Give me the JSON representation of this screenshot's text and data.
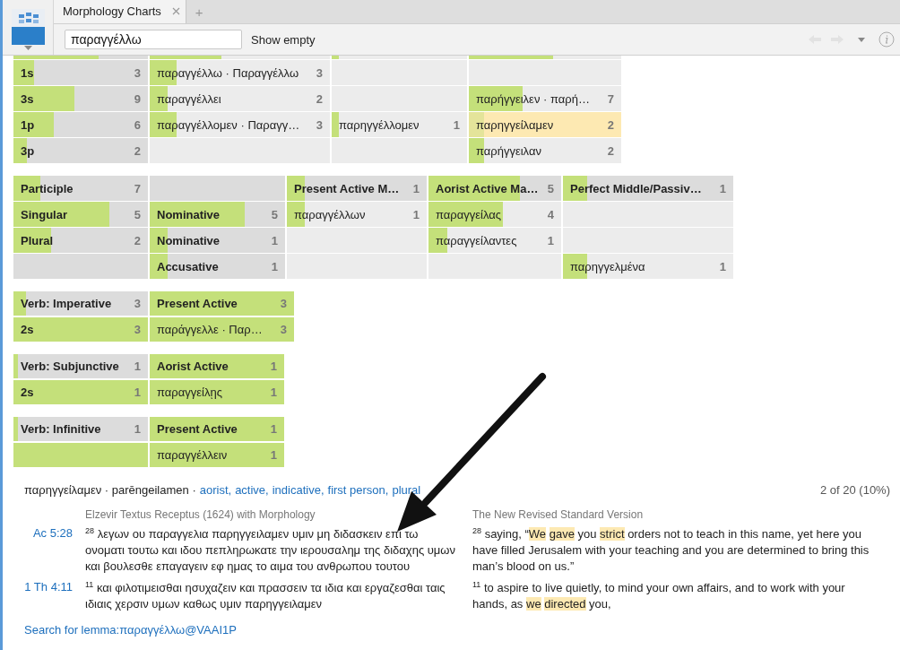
{
  "tabs": [
    {
      "label": "Morphology Charts",
      "selected": true
    }
  ],
  "new_tab": "+",
  "toolbar": {
    "search": {
      "value": "παραγγέλλω"
    },
    "show_empty": "Show empty",
    "back": {
      "disabled": true
    },
    "forward": {
      "disabled": true
    }
  },
  "charts": [
    {
      "rows": [
        [
          {
            "kind": "category",
            "level": 0.63
          },
          {
            "kind": "form",
            "level": 0.4
          },
          {
            "kind": "form",
            "level": 0.05
          },
          {
            "kind": "form",
            "level": 0.55
          }
        ],
        [
          {
            "kind": "category",
            "label": "1s",
            "count": "3",
            "level": 0.15
          },
          {
            "kind": "form",
            "label": "παραγγέλλω · Παραγγέλλω",
            "count": "3",
            "level": 0.15,
            "selected": false
          },
          {
            "kind": "empty"
          },
          {
            "kind": "empty"
          }
        ],
        [
          {
            "kind": "category",
            "label": "3s",
            "count": "9",
            "level": 0.45
          },
          {
            "kind": "form",
            "label": "παραγγέλλει",
            "count": "2",
            "level": 0.1,
            "selected": false
          },
          {
            "kind": "empty"
          },
          {
            "kind": "form",
            "label": "παρήγγειλεν · παρή…",
            "count": "7",
            "level": 0.35,
            "selected": false
          }
        ],
        [
          {
            "kind": "category",
            "label": "1p",
            "count": "6",
            "level": 0.3
          },
          {
            "kind": "form",
            "label": "παραγγέλλομεν · Παραγγ…",
            "count": "3",
            "level": 0.15,
            "selected": false
          },
          {
            "kind": "form",
            "label": "παρηγγέλλομεν",
            "count": "1",
            "level": 0.05,
            "selected": false
          },
          {
            "kind": "form",
            "label": "παρηγγείλαμεν",
            "count": "2",
            "level": 0.1,
            "selected": true
          }
        ],
        [
          {
            "kind": "category",
            "label": "3p",
            "count": "2",
            "level": 0.1
          },
          {
            "kind": "empty"
          },
          {
            "kind": "empty"
          },
          {
            "kind": "form",
            "label": "παρήγγειλαν",
            "count": "2",
            "level": 0.1,
            "selected": false
          }
        ]
      ]
    },
    {
      "rows": [
        [
          {
            "kind": "category",
            "label": "Participle",
            "count": "7",
            "level": 0.2
          },
          {
            "kind": "empty_category"
          },
          {
            "kind": "category",
            "label": "Present Active M…",
            "count": "1",
            "level": 0.13
          },
          {
            "kind": "category",
            "label": "Aorist Active Ma…",
            "count": "5",
            "level": 0.69
          },
          {
            "kind": "category",
            "label": "Perfect Middle/Passiv…",
            "count": "1",
            "level": 0.14
          }
        ],
        [
          {
            "kind": "category",
            "label": "Singular",
            "count": "5",
            "level": 0.71
          },
          {
            "kind": "category",
            "label": "Nominative",
            "count": "5",
            "level": 0.7
          },
          {
            "kind": "form",
            "label": "παραγγέλλων",
            "count": "1",
            "level": 0.13,
            "selected": false
          },
          {
            "kind": "form",
            "label": "παραγγείλας",
            "count": "4",
            "level": 0.56,
            "selected": false
          },
          {
            "kind": "empty"
          }
        ],
        [
          {
            "kind": "category",
            "label": "Plural",
            "count": "2",
            "level": 0.28
          },
          {
            "kind": "category",
            "label": "Nominative",
            "count": "1",
            "level": 0.13
          },
          {
            "kind": "empty"
          },
          {
            "kind": "form",
            "label": "παραγγείλαντες",
            "count": "1",
            "level": 0.14,
            "selected": false
          },
          {
            "kind": "empty"
          }
        ],
        [
          {
            "kind": "empty_category"
          },
          {
            "kind": "category",
            "label": "Accusative",
            "count": "1",
            "level": 0.13
          },
          {
            "kind": "empty"
          },
          {
            "kind": "empty"
          },
          {
            "kind": "form",
            "label": "παρηγγελμένα",
            "count": "1",
            "level": 0.14,
            "selected": false
          }
        ]
      ]
    },
    {
      "rows": [
        [
          {
            "kind": "category",
            "label": "Verb: Imperative",
            "count": "3",
            "level": 0.09
          },
          {
            "kind": "category",
            "label": "Present Active",
            "count": "3",
            "level": 1
          }
        ],
        [
          {
            "kind": "category",
            "label": "2s",
            "count": "3",
            "level": 1
          },
          {
            "kind": "form",
            "label": "παράγγελλε · Παρ…",
            "count": "3",
            "level": 1,
            "selected": false
          }
        ]
      ]
    },
    {
      "rows": [
        [
          {
            "kind": "category",
            "label": "Verb: Subjunctive",
            "count": "1",
            "level": 0.03
          },
          {
            "kind": "category",
            "label": "Aorist Active",
            "count": "1",
            "level": 1
          }
        ],
        [
          {
            "kind": "category",
            "label": "2s",
            "count": "1",
            "level": 1
          },
          {
            "kind": "form",
            "label": "παραγγείλῃς",
            "count": "1",
            "level": 1,
            "selected": false
          }
        ]
      ]
    },
    {
      "rows": [
        [
          {
            "kind": "category",
            "label": "Verb: Infinitive",
            "count": "1",
            "level": 0.03
          },
          {
            "kind": "category",
            "label": "Present Active",
            "count": "1",
            "level": 1
          }
        ],
        [
          {
            "kind": "empty_category",
            "level": 1
          },
          {
            "kind": "form",
            "label": "παραγγέλλειν",
            "count": "1",
            "level": 1,
            "selected": false
          }
        ]
      ]
    }
  ],
  "details": {
    "form_line": "παρηγγείλαμεν · parēngeilamen ·",
    "parsing_links": [
      "aorist,",
      "active,",
      "indicative,",
      "first person,",
      "plural"
    ],
    "position": "2 of 20 (10%)",
    "versions": [
      "Elzevir Textus Receptus (1624) with Morphology",
      "The New Revised Standard Version"
    ],
    "verses": [
      {
        "reference": "Ac 5:28",
        "greek": {
          "verse_number": "28",
          "text": "λεγων ου παραγγελια παρηγγειλαμεν υμιν μη διδασκειν επι τω ονοματι τουτω και ιδου πεπληρωκατε την ιερουσαλημ της διδαχης υμων και βουλεσθε επαγαγειν εφ ημας το αιμα του ανθρωπου τουτου"
        },
        "english": {
          "verse_number": "28",
          "segments": [
            {
              "text": "saying, “",
              "highlighted": false
            },
            {
              "text": "We ",
              "highlighted": true
            },
            {
              "text": "gave",
              "highlighted": true
            },
            {
              "text": " you ",
              "highlighted": false
            },
            {
              "text": "strict",
              "highlighted": true
            },
            {
              "text": " orders not to teach in this name, yet here you have filled Jerusalem with your teaching and you are determined to bring this man’s blood on us.”",
              "highlighted": false
            }
          ]
        }
      },
      {
        "reference": "1 Th 4:11",
        "greek": {
          "verse_number": "11",
          "text": "και φιλοτιμεισθαι ησυχαζειν και πρασσειν τα ιδια και εργαζεσθαι ταις ιδιαις χερσιν υμων καθως υμιν παρηγγειλαμεν"
        },
        "english": {
          "verse_number": "11",
          "segments": [
            {
              "text": "to aspire to live quietly, to mind your own affairs, and to work with your hands, as ",
              "highlighted": false
            },
            {
              "text": "we ",
              "highlighted": true
            },
            {
              "text": "directed",
              "highlighted": true
            },
            {
              "text": " you,",
              "highlighted": false
            }
          ]
        }
      }
    ],
    "search_link": "Search for lemma:παραγγέλλω@VAAI1P"
  },
  "annotation": {
    "kind": "arrow"
  }
}
